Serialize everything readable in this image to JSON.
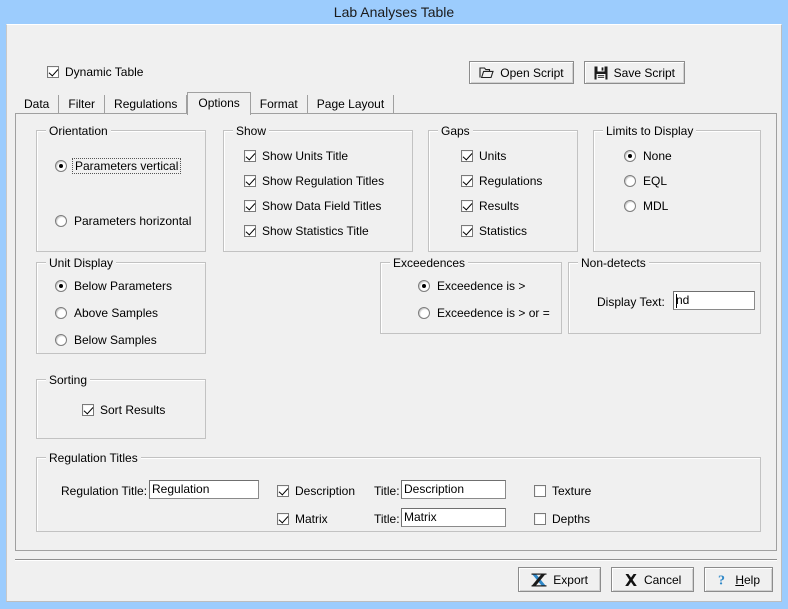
{
  "window": {
    "title": "Lab Analyses Table"
  },
  "topbar": {
    "dynamic_table_label": "Dynamic Table",
    "dynamic_table_checked": true,
    "open_script_label": "Open Script",
    "save_script_label": "Save Script"
  },
  "tabs": [
    {
      "label": "Data",
      "active": false
    },
    {
      "label": "Filter",
      "active": false
    },
    {
      "label": "Regulations",
      "active": false
    },
    {
      "label": "Options",
      "active": true
    },
    {
      "label": "Format",
      "active": false
    },
    {
      "label": "Page Layout",
      "active": false
    }
  ],
  "orientation": {
    "legend": "Orientation",
    "options": [
      {
        "label": "Parameters vertical",
        "selected": true,
        "focused": true
      },
      {
        "label": "Parameters horizontal",
        "selected": false,
        "focused": false
      }
    ]
  },
  "show": {
    "legend": "Show",
    "items": [
      {
        "label": "Show Units Title",
        "checked": true
      },
      {
        "label": "Show Regulation Titles",
        "checked": true
      },
      {
        "label": "Show Data Field Titles",
        "checked": true
      },
      {
        "label": "Show Statistics Title",
        "checked": true
      }
    ]
  },
  "gaps": {
    "legend": "Gaps",
    "items": [
      {
        "label": "Units",
        "checked": true
      },
      {
        "label": "Regulations",
        "checked": true
      },
      {
        "label": "Results",
        "checked": true
      },
      {
        "label": "Statistics",
        "checked": true
      }
    ]
  },
  "limits": {
    "legend": "Limits to Display",
    "options": [
      {
        "label": "None",
        "selected": true
      },
      {
        "label": "EQL",
        "selected": false
      },
      {
        "label": "MDL",
        "selected": false
      }
    ]
  },
  "unit_display": {
    "legend": "Unit Display",
    "options": [
      {
        "label": "Below Parameters",
        "selected": true
      },
      {
        "label": "Above Samples",
        "selected": false
      },
      {
        "label": "Below Samples",
        "selected": false
      }
    ]
  },
  "exceedences": {
    "legend": "Exceedences",
    "options": [
      {
        "label": "Exceedence is >",
        "selected": true
      },
      {
        "label": "Exceedence is > or =",
        "selected": false
      }
    ]
  },
  "non_detects": {
    "legend": "Non-detects",
    "display_text_label": "Display Text:",
    "display_text_value": "nd"
  },
  "sorting": {
    "legend": "Sorting",
    "sort_results_label": "Sort Results",
    "sort_results_checked": true
  },
  "regulation_titles": {
    "legend": "Regulation Titles",
    "regulation_title_label": "Regulation Title:",
    "regulation_title_value": "Regulation",
    "description_label": "Description",
    "description_checked": true,
    "description_title_label": "Title:",
    "description_title_value": "Description",
    "matrix_label": "Matrix",
    "matrix_checked": true,
    "matrix_title_label": "Title:",
    "matrix_title_value": "Matrix",
    "texture_label": "Texture",
    "texture_checked": false,
    "depths_label": "Depths",
    "depths_checked": false
  },
  "footer": {
    "export_label": "Export",
    "cancel_label": "Cancel",
    "help_label_first": "H",
    "help_label_rest": "elp"
  },
  "colors": {
    "titlebar": "#9cccfd",
    "dialog_face": "#f0f0f0",
    "group_border": "#c2c2c2",
    "field_bg": "#ffffff",
    "excel_icon": "#2f88c8"
  }
}
